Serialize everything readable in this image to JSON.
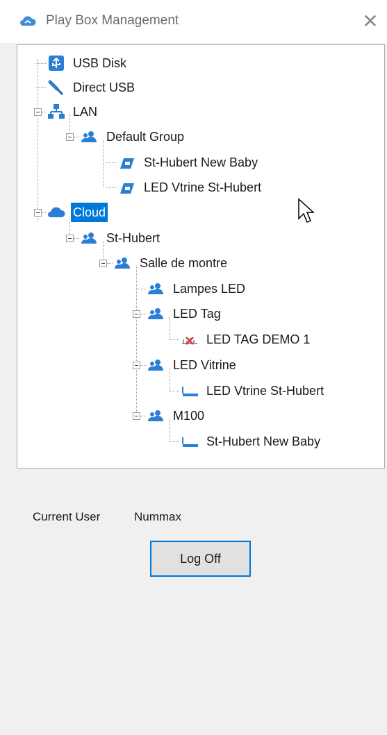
{
  "window": {
    "title": "Play Box Management",
    "close_glyph": "✕",
    "title_icon": "cloud-share-icon"
  },
  "tree": {
    "nodes": [
      {
        "label": "USB Disk",
        "icon": "usb-icon"
      },
      {
        "label": "Direct USB",
        "icon": "usb-cable-icon"
      },
      {
        "label": "LAN",
        "icon": "network-icon"
      },
      {
        "label": "Default Group",
        "icon": "group-icon"
      },
      {
        "label": "St-Hubert New Baby",
        "icon": "player-icon"
      },
      {
        "label": "LED Vtrine St-Hubert",
        "icon": "player-icon"
      },
      {
        "label": "Cloud",
        "icon": "cloud-icon",
        "selected": true
      },
      {
        "label": "St-Hubert",
        "icon": "group-icon"
      },
      {
        "label": "Salle de montre",
        "icon": "group-icon"
      },
      {
        "label": "Lampes LED",
        "icon": "group-icon"
      },
      {
        "label": "LED Tag",
        "icon": "group-icon"
      },
      {
        "label": "LED TAG DEMO 1",
        "icon": "device-offline-icon"
      },
      {
        "label": "LED Vitrine",
        "icon": "group-icon"
      },
      {
        "label": "LED Vtrine St-Hubert",
        "icon": "led-display-icon"
      },
      {
        "label": "M100",
        "icon": "group-icon"
      },
      {
        "label": "St-Hubert New Baby",
        "icon": "led-display-icon"
      }
    ]
  },
  "footer": {
    "current_user_label": "Current User",
    "current_user_value": "Nummax",
    "logoff_label": "Log Off"
  },
  "colors": {
    "accent": "#0078d7",
    "icon_blue": "#2a7fd4",
    "offline_red": "#d23a3a"
  }
}
